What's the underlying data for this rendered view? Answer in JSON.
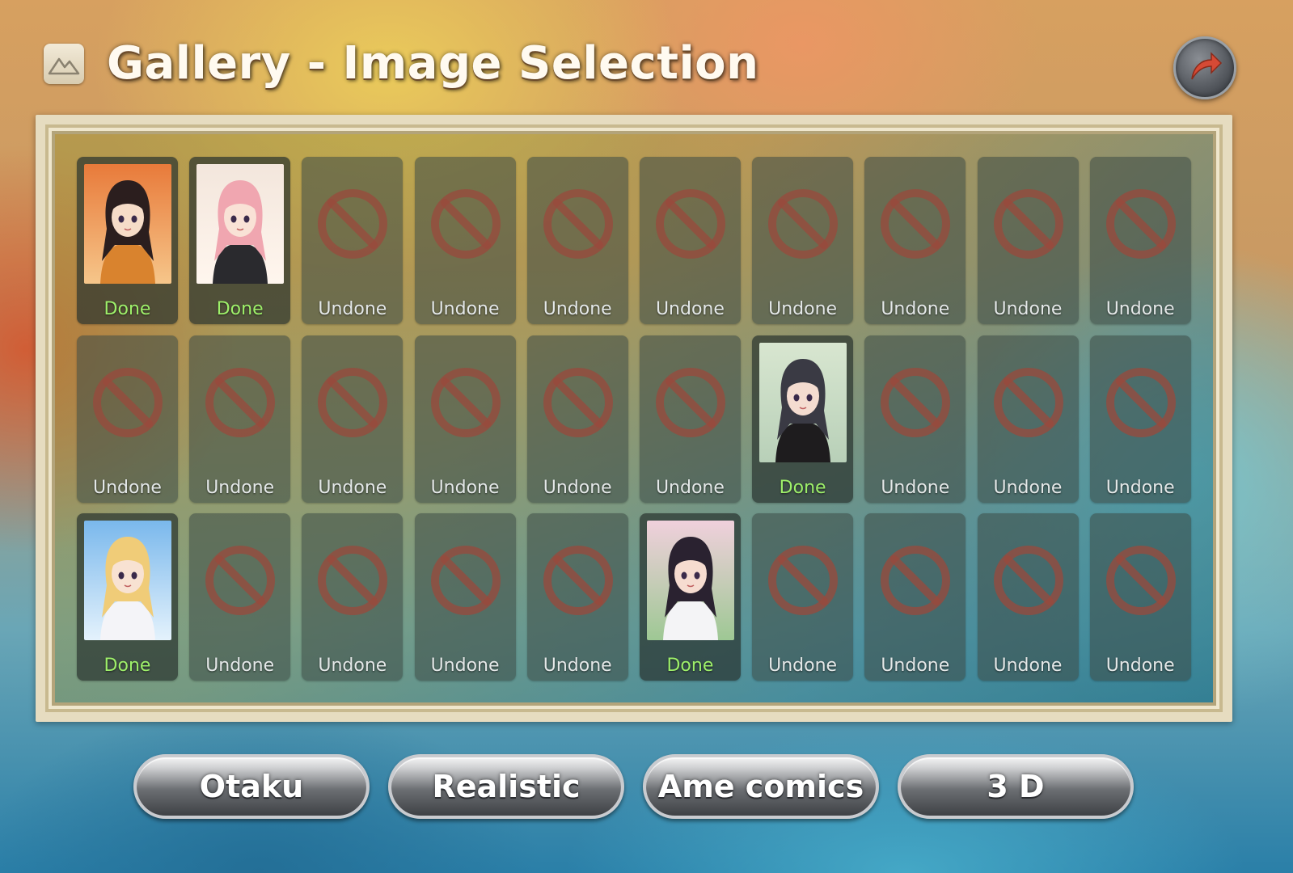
{
  "header": {
    "title": "Gallery - Image Selection",
    "icon": "landscape-image-icon",
    "return_icon": "return-arrow-icon"
  },
  "gallery": {
    "done_label": "Done",
    "undone_label": "Undone",
    "locked_icon": "prohibited-icon",
    "cards": [
      {
        "status": "Done",
        "art": "girl-autumn-orange-sweater"
      },
      {
        "status": "Done",
        "art": "pink-hair-girl-wink"
      },
      {
        "status": "Undone"
      },
      {
        "status": "Undone"
      },
      {
        "status": "Undone"
      },
      {
        "status": "Undone"
      },
      {
        "status": "Undone"
      },
      {
        "status": "Undone"
      },
      {
        "status": "Undone"
      },
      {
        "status": "Undone"
      },
      {
        "status": "Undone"
      },
      {
        "status": "Undone"
      },
      {
        "status": "Undone"
      },
      {
        "status": "Undone"
      },
      {
        "status": "Undone"
      },
      {
        "status": "Undone"
      },
      {
        "status": "Done",
        "art": "short-hair-girl-black-sweater"
      },
      {
        "status": "Undone"
      },
      {
        "status": "Undone"
      },
      {
        "status": "Undone"
      },
      {
        "status": "Done",
        "art": "blonde-girl-sky-flowers"
      },
      {
        "status": "Undone"
      },
      {
        "status": "Undone"
      },
      {
        "status": "Undone"
      },
      {
        "status": "Undone"
      },
      {
        "status": "Done",
        "art": "girl-cherry-blossom-uniform"
      },
      {
        "status": "Undone"
      },
      {
        "status": "Undone"
      },
      {
        "status": "Undone"
      },
      {
        "status": "Undone"
      }
    ]
  },
  "tabs": [
    {
      "label": "Otaku"
    },
    {
      "label": "Realistic"
    },
    {
      "label": "Ame comics"
    },
    {
      "label": "3 D"
    }
  ],
  "colors": {
    "done_text": "#9ef06a",
    "undone_text": "#e4e8e8",
    "prohibited_red": "#9a4a3c"
  }
}
